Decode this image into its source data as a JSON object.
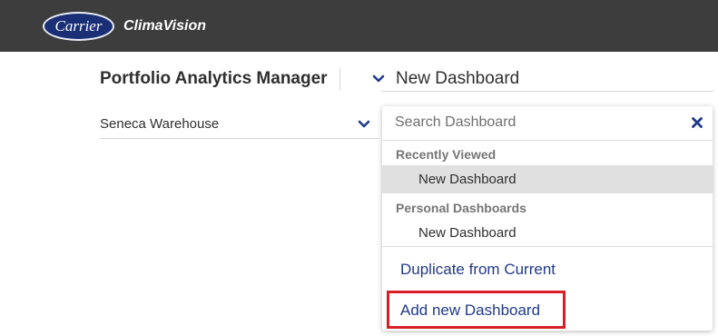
{
  "header": {
    "logo_text": "Carrier",
    "brand": "ClimaVision"
  },
  "page": {
    "title": "Portfolio Analytics Manager",
    "current_dashboard": "New Dashboard",
    "site": "Seneca Warehouse"
  },
  "dropdown": {
    "search_placeholder": "Search Dashboard",
    "groups": [
      {
        "label": "Recently Viewed",
        "items": [
          {
            "label": "New Dashboard",
            "selected": true
          }
        ]
      },
      {
        "label": "Personal Dashboards",
        "items": [
          {
            "label": "New Dashboard",
            "selected": false
          }
        ]
      }
    ],
    "actions": {
      "duplicate": "Duplicate from Current",
      "add_new": "Add new Dashboard"
    }
  },
  "colors": {
    "topbar": "#3d3d3d",
    "logo_blue": "#1a2f75",
    "link_blue": "#1f3a8a",
    "highlight_red": "#d81f26",
    "selected_row": "#e0e0e0"
  },
  "icons": {
    "dashboard_selector": "chevron-down-icon",
    "site_selector": "chevron-down-icon",
    "search_clear": "close-icon"
  }
}
